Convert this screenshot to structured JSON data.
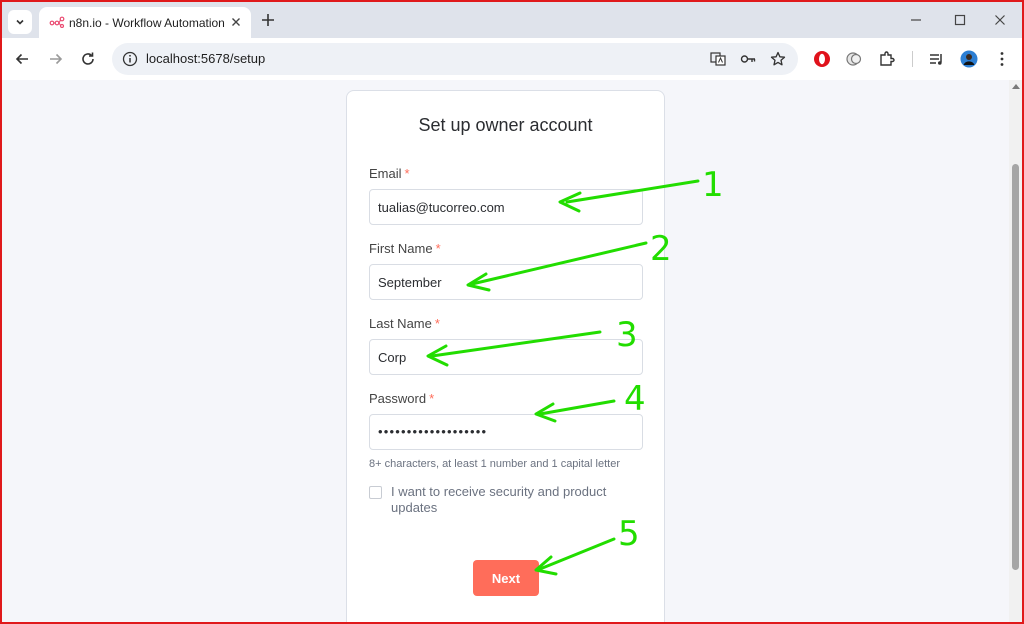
{
  "browser": {
    "tab_title": "n8n.io - Workflow Automation",
    "url": "localhost:5678/setup"
  },
  "form": {
    "title": "Set up owner account",
    "email": {
      "label": "Email",
      "required_mark": "*",
      "value": "tualias@tucorreo.com"
    },
    "first_name": {
      "label": "First Name",
      "required_mark": "*",
      "value": "September"
    },
    "last_name": {
      "label": "Last Name",
      "required_mark": "*",
      "value": "Corp"
    },
    "password": {
      "label": "Password",
      "required_mark": "*",
      "value": "•••••••••••••••••••",
      "hint": "8+ characters, at least 1 number and 1 capital letter"
    },
    "newsletter": {
      "label": "I want to receive security and product updates",
      "checked": false
    },
    "next_label": "Next"
  },
  "annotations": {
    "color": "#22dd00",
    "steps": [
      "1",
      "2",
      "3",
      "4",
      "5"
    ]
  },
  "colors": {
    "accent": "#ff6d5a",
    "frame": "#e0191b"
  }
}
